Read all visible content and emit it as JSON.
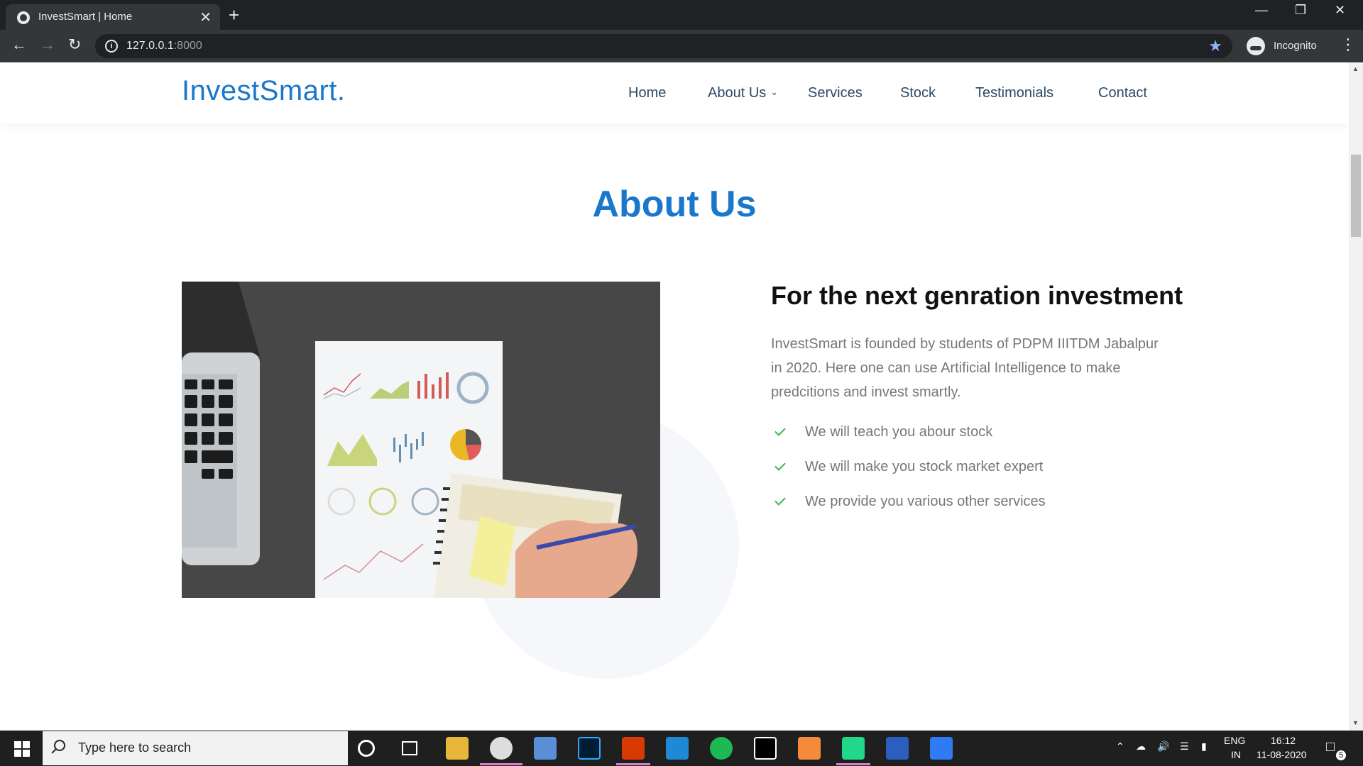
{
  "browser": {
    "tab_title": "InvestSmart | Home",
    "tab_close": "✕",
    "new_tab": "+",
    "url_host": "127.0.0.1",
    "url_port": ":8000",
    "profile_label": "Incognito"
  },
  "site": {
    "logo": "InvestSmart.",
    "nav": [
      {
        "label": "Home"
      },
      {
        "label": "About Us"
      },
      {
        "label": "Services"
      },
      {
        "label": "Stock"
      },
      {
        "label": "Testimonials"
      },
      {
        "label": "Contact"
      }
    ]
  },
  "about": {
    "section_title": "About Us",
    "heading": "For the next genration investment",
    "paragraph": "InvestSmart is founded by students of PDPM IIITDM Jabalpur in 2020. Here one can use Artificial Intelligence to make predcitions and invest smartly.",
    "points": [
      "We will teach you abour stock",
      "We will make you stock market expert",
      "We provide you various other services"
    ]
  },
  "taskbar": {
    "search_placeholder": "Type here to search",
    "lang_line1": "ENG",
    "lang_line2": "IN",
    "time": "16:12",
    "date": "11-08-2020",
    "notification_count": "5",
    "apps": [
      "cortana-icon",
      "task-view-icon",
      "file-explorer-icon",
      "chrome-icon",
      "app-icon",
      "photoshop-icon",
      "office-icon",
      "vscode-icon",
      "spotify-icon",
      "dolby-icon",
      "app-orange-icon",
      "pycharm-icon",
      "powershell-icon",
      "wps-icon"
    ]
  },
  "colors": {
    "brand": "#1977cc",
    "nav_text": "#2c4964",
    "check": "#3ab54a"
  }
}
